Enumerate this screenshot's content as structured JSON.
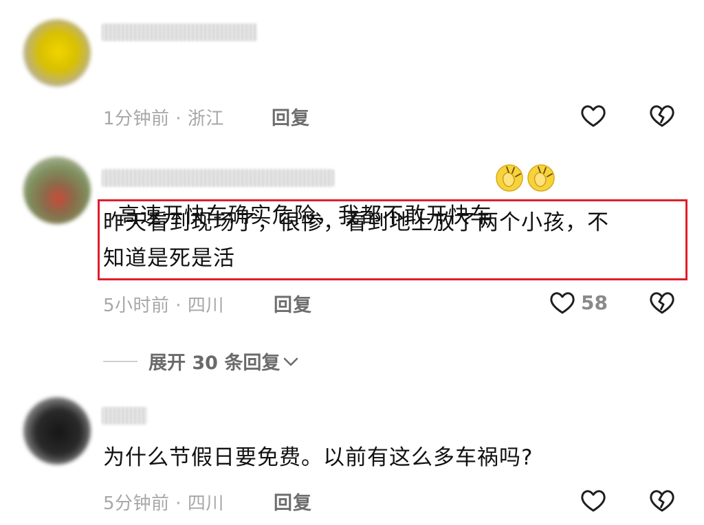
{
  "comments": [
    {
      "text": "高速开快车确实危险，我都不敢开快车",
      "emoji": "clapping-hands",
      "time": "1分钟前",
      "location": "浙江",
      "reply_label": "回复",
      "likes": ""
    },
    {
      "text": "昨天看到现场了，很惨，看到地上放了两个小孩，不\n知道是死是活",
      "time": "5小时前",
      "location": "四川",
      "reply_label": "回复",
      "likes": "58"
    },
    {
      "text": "为什么节假日要免费。以前有这么多车祸吗?",
      "time": "5分钟前",
      "location": "四川",
      "reply_label": "回复",
      "likes": ""
    }
  ],
  "expand_replies": {
    "label": "展开 30 条回复"
  },
  "icons": {
    "like": "heart-outline-icon",
    "dislike": "broken-heart-icon",
    "expand": "chevron-down-icon"
  },
  "colors": {
    "highlight_border": "#e11d2b",
    "meta_text": "#a7a7a7",
    "reply_text": "#6d6d6d"
  }
}
